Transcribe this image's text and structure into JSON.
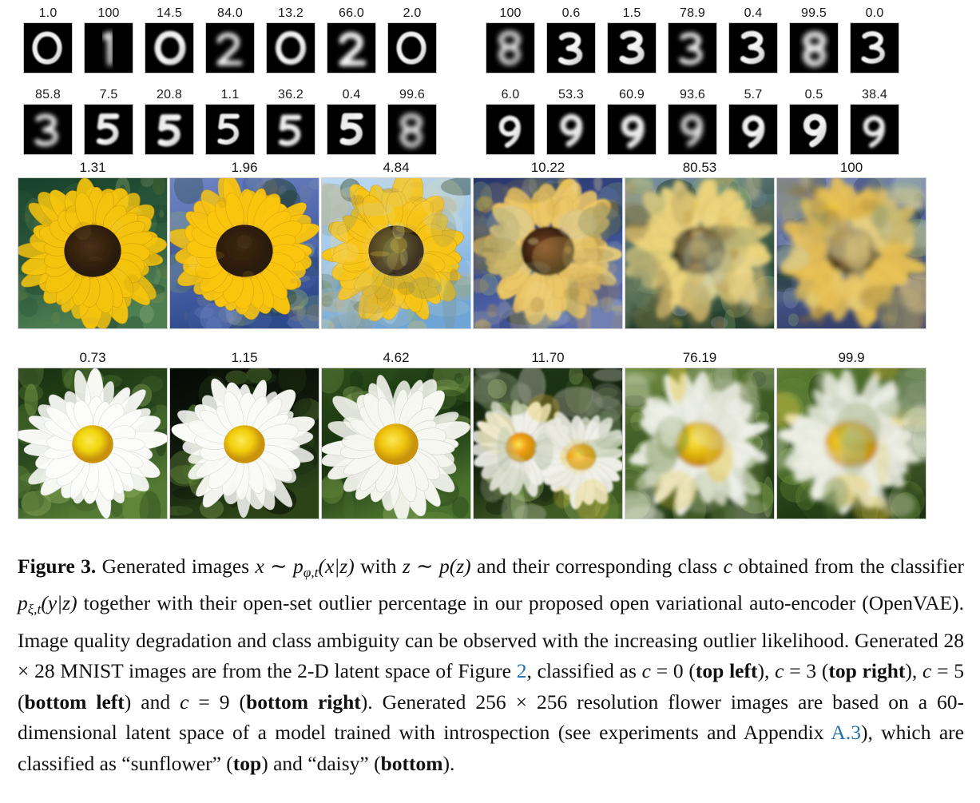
{
  "figure": {
    "label": "Figure 3.",
    "mnist_rows": [
      {
        "name": "top-row",
        "left_group": {
          "class_label": "0",
          "percentages": [
            "1.0",
            "100",
            "14.5",
            "84.0",
            "13.2",
            "66.0",
            "2.0"
          ],
          "digits": [
            "0",
            "1",
            "0",
            "2",
            "0",
            "2",
            "0"
          ]
        },
        "right_group": {
          "class_label": "3",
          "percentages": [
            "100",
            "0.6",
            "1.5",
            "78.9",
            "0.4",
            "99.5",
            "0.0"
          ],
          "digits": [
            "8",
            "3",
            "3",
            "3",
            "3",
            "8",
            "3"
          ]
        }
      },
      {
        "name": "bottom-row",
        "left_group": {
          "class_label": "5",
          "percentages": [
            "85.8",
            "7.5",
            "20.8",
            "1.1",
            "36.2",
            "0.4",
            "99.6"
          ],
          "digits": [
            "3",
            "5",
            "5",
            "5",
            "5",
            "5",
            "8"
          ]
        },
        "right_group": {
          "class_label": "9",
          "percentages": [
            "6.0",
            "53.3",
            "60.9",
            "93.6",
            "5.7",
            "0.5",
            "38.4"
          ],
          "digits": [
            "9",
            "9",
            "9",
            "9",
            "9",
            "9",
            "9"
          ]
        }
      }
    ],
    "flower_rows": [
      {
        "name": "sunflower-row",
        "class_label": "sunflower",
        "percentages": [
          "1.31",
          "1.96",
          "4.84",
          "10.22",
          "80.53",
          "100"
        ]
      },
      {
        "name": "daisy-row",
        "class_label": "daisy",
        "percentages": [
          "0.73",
          "1.15",
          "4.62",
          "11.70",
          "76.19",
          "99.9"
        ]
      }
    ]
  },
  "caption": {
    "bold_prefix": "Figure 3.",
    "s1": " Generated images ",
    "m1": "x",
    "s2": " ∼ ",
    "m2": "p",
    "m2sub": "φ,t",
    "m3": "(",
    "m4": "x",
    "m5": "|",
    "m6": "z",
    "m7": ")",
    "s3": " with ",
    "m8": "z",
    "s4": " ∼ ",
    "m9": "p",
    "m10": "(",
    "m11": "z",
    "m12": ")",
    "s5": " and their corresponding class ",
    "m13": "c",
    "s6": " obtained from the classifier ",
    "m14": "p",
    "m14sub": "ξ,t",
    "m15": "(",
    "m16": "y",
    "m17": "|",
    "m18": "z",
    "m19": ")",
    "s7": " together with their open-set outlier percentage in our proposed open variational auto-encoder (OpenVAE). Image quality degradation and class ambiguity can be observed with the increasing outlier likelihood. Generated 28 × 28 MNIST images are from the 2-D latent space of Figure ",
    "link_figure2": "2",
    "s8": ", classified as ",
    "m20": "c",
    "s9": " = 0 (",
    "b1": "top left",
    "s10": "), ",
    "m21": "c",
    "s11": " = 3 (",
    "b2": "top right",
    "s12": "), ",
    "m22": "c",
    "s13": " = 5 (",
    "b3": "bottom left",
    "s14": ") and ",
    "m23": "c",
    "s15": " = 9 (",
    "b4": "bottom right",
    "s16": "). Generated 256 × 256 resolution flower images are based on a 60-dimensional latent space of a model trained with introspection (see experiments and Appendix ",
    "link_appendix": "A.3",
    "s17": "), which are classified as “sunflower” (",
    "b5": "top",
    "s18": ") and “daisy” (",
    "b6": "bottom",
    "s19": ")."
  },
  "colors": {
    "link": "#1f6fb4",
    "text": "#101010",
    "tile_border": "#c8c8c8",
    "mnist_bg": "#000000"
  }
}
